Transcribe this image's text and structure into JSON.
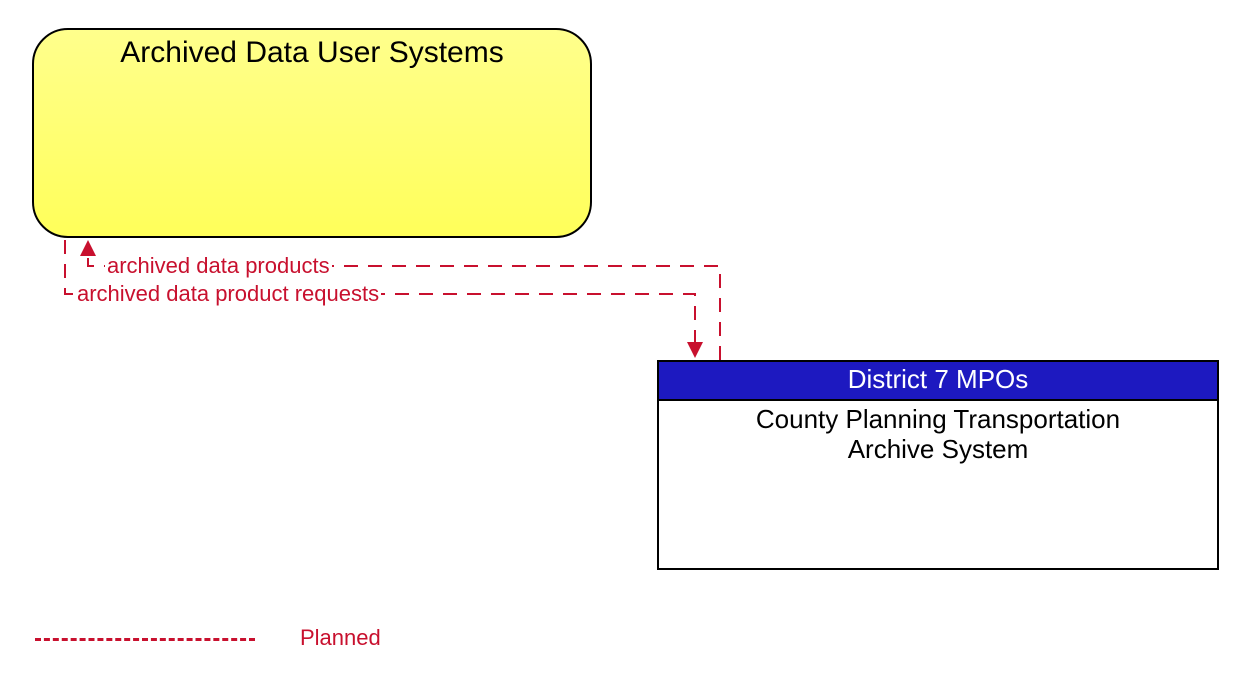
{
  "box_yellow": {
    "title": "Archived Data User Systems"
  },
  "box_district": {
    "header": "District 7 MPOs",
    "body_line1": "County Planning Transportation",
    "body_line2": "Archive System"
  },
  "flows": {
    "flow1": "archived data products",
    "flow2": "archived data product requests"
  },
  "legend": {
    "planned": "Planned"
  },
  "colors": {
    "flow_red": "#c8102e",
    "header_blue": "#1d19c0",
    "box_yellow_top": "#ffff8c",
    "box_yellow_bottom": "#ffff5a"
  }
}
